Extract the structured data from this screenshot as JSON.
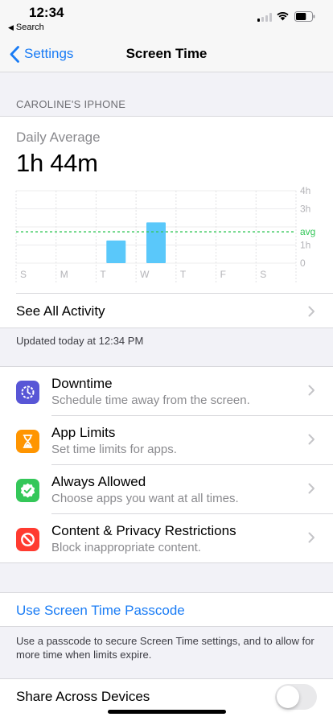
{
  "status": {
    "time": "12:34",
    "back_app": "Search",
    "signal_icon": "cellular-signal-icon",
    "wifi_icon": "wifi-icon",
    "battery_icon": "battery-icon",
    "signal_bars_active": 1,
    "battery_level": 0.65
  },
  "nav": {
    "back_label": "Settings",
    "title": "Screen Time"
  },
  "device_label": "CAROLINE'S IPHONE",
  "usage": {
    "label": "Daily Average",
    "value": "1h 44m",
    "see_all": "See All Activity",
    "updated": "Updated today at 12:34 PM"
  },
  "chart_data": {
    "type": "bar",
    "categories": [
      "S",
      "M",
      "T",
      "W",
      "T",
      "F",
      "S"
    ],
    "values": [
      0,
      0,
      1.25,
      2.25,
      0,
      0,
      0
    ],
    "y_ticks": [
      "0",
      "1h",
      "3h",
      "4h"
    ],
    "y_tick_values": [
      0,
      1,
      3,
      4
    ],
    "ylim": [
      0,
      4
    ],
    "average_label": "avg",
    "average_value": 1.73,
    "bar_color": "#5ac8fa",
    "avg_color": "#34c759",
    "grid": true
  },
  "features": [
    {
      "title": "Downtime",
      "subtitle": "Schedule time away from the screen.",
      "icon": "downtime-icon",
      "color": "#5856d6"
    },
    {
      "title": "App Limits",
      "subtitle": "Set time limits for apps.",
      "icon": "hourglass-icon",
      "color": "#ff9500"
    },
    {
      "title": "Always Allowed",
      "subtitle": "Choose apps you want at all times.",
      "icon": "checkmark-badge-icon",
      "color": "#34c759"
    },
    {
      "title": "Content & Privacy Restrictions",
      "subtitle": "Block inappropriate content.",
      "icon": "restriction-icon",
      "color": "#ff3b30"
    }
  ],
  "passcode": {
    "link": "Use Screen Time Passcode",
    "note": "Use a passcode to secure Screen Time settings, and to allow for more time when limits expire."
  },
  "share": {
    "label": "Share Across Devices",
    "enabled": false
  },
  "colors": {
    "accent": "#1a7cf5"
  }
}
